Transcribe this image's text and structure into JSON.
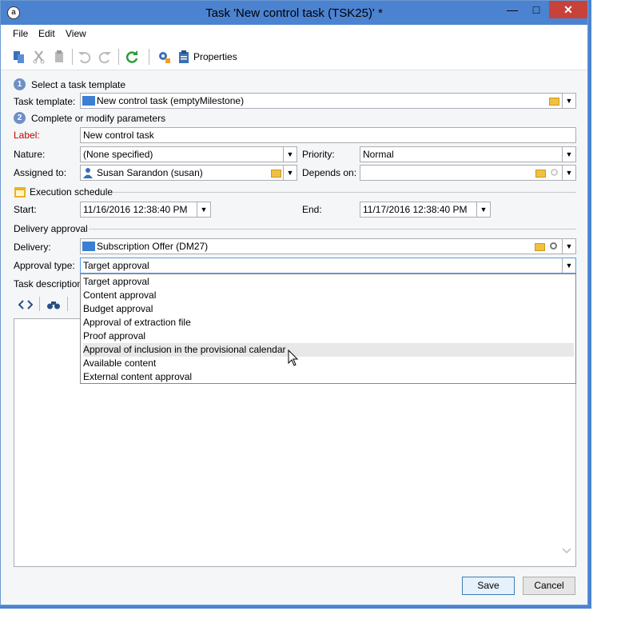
{
  "window": {
    "title": "Task 'New control task (TSK25)' *"
  },
  "menu": [
    "File",
    "Edit",
    "View"
  ],
  "toolbar": {
    "properties_label": "Properties"
  },
  "section1": {
    "step": "1",
    "title": "Select a task template"
  },
  "template": {
    "label": "Task template:",
    "value": "New control task (emptyMilestone)"
  },
  "section2": {
    "step": "2",
    "title": "Complete or modify parameters"
  },
  "label_field": {
    "label": "Label:",
    "value": "New control task"
  },
  "nature": {
    "label": "Nature:",
    "value": "(None specified)"
  },
  "priority": {
    "label": "Priority:",
    "value": "Normal"
  },
  "assigned": {
    "label": "Assigned to:",
    "value": "Susan Sarandon (susan)"
  },
  "depends": {
    "label": "Depends on:",
    "value": ""
  },
  "schedule": {
    "title": "Execution schedule"
  },
  "start": {
    "label": "Start:",
    "value": "11/16/2016 12:38:40 PM"
  },
  "end": {
    "label": "End:",
    "value": "11/17/2016 12:38:40 PM"
  },
  "delivery_approval": {
    "title": "Delivery approval"
  },
  "delivery": {
    "label": "Delivery:",
    "value": "Subscription Offer (DM27)"
  },
  "approval_type": {
    "label": "Approval type:",
    "value": "Target approval",
    "options": [
      "Target approval",
      "Content approval",
      "Budget approval",
      "Approval of extraction file",
      "Proof approval",
      "Approval of inclusion in the provisional calendar",
      "Available content",
      "External content approval"
    ]
  },
  "task_description": {
    "label": "Task description"
  },
  "buttons": {
    "save": "Save",
    "cancel": "Cancel"
  },
  "colors": {
    "titlebar": "#4b83d1",
    "close": "#c7423a",
    "required_label": "#c00000"
  }
}
